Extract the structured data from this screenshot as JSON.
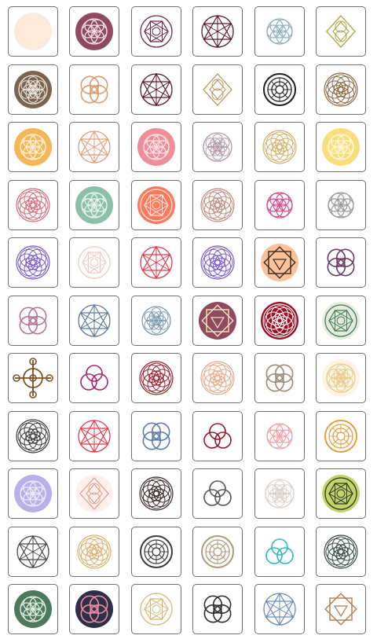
{
  "gallery": {
    "icons": [
      {
        "name": "rose-mandala-icon",
        "bg": "#fdeadb",
        "stroke": "#a8324a",
        "motif": "rose"
      },
      {
        "name": "seed-of-life-icon",
        "bg": "#8e4a60",
        "stroke": "#f6e6ea",
        "motif": "seed"
      },
      {
        "name": "hexagon-mandala-icon",
        "bg": "",
        "stroke": "#6b2a4a",
        "motif": "hexring"
      },
      {
        "name": "star-flower-icon",
        "bg": "",
        "stroke": "#5a1a2e",
        "motif": "star"
      },
      {
        "name": "interlaced-circles-icon",
        "bg": "",
        "stroke": "#8fb2ba",
        "motif": "seed"
      },
      {
        "name": "vesica-diamond-icon",
        "bg": "",
        "stroke": "#a8a23a",
        "motif": "diamond"
      },
      {
        "name": "flower-of-life-icon",
        "bg": "#7a6450",
        "stroke": "#f3ece3",
        "motif": "flower"
      },
      {
        "name": "knot-rings-icon",
        "bg": "",
        "stroke": "#d89a6f",
        "motif": "knot"
      },
      {
        "name": "star-flower-icon",
        "bg": "",
        "stroke": "#5a1a2e",
        "motif": "star"
      },
      {
        "name": "diamond-arrow-icon",
        "bg": "",
        "stroke": "#b8975a",
        "motif": "diamond"
      },
      {
        "name": "concentric-circles-icon",
        "bg": "",
        "stroke": "#1f1f1f",
        "motif": "rings"
      },
      {
        "name": "rosette-ring-icon",
        "bg": "",
        "stroke": "#8a6a44",
        "motif": "rosette"
      },
      {
        "name": "seed-of-life-icon",
        "bg": "#f3b758",
        "stroke": "#fdf2dc",
        "motif": "seed"
      },
      {
        "name": "star-flower-icon",
        "bg": "",
        "stroke": "#dba07e",
        "motif": "star"
      },
      {
        "name": "seed-of-life-icon",
        "bg": "#ec8f98",
        "stroke": "#fbe3e6",
        "motif": "seed"
      },
      {
        "name": "flower-of-life-icon",
        "bg": "",
        "stroke": "#b197a5",
        "motif": "flower"
      },
      {
        "name": "rosette-ring-icon",
        "bg": "",
        "stroke": "#d1b06a",
        "motif": "rosette"
      },
      {
        "name": "seed-of-life-icon",
        "bg": "#f7df7e",
        "stroke": "#fff7d8",
        "motif": "seed"
      },
      {
        "name": "rosette-ring-icon",
        "bg": "",
        "stroke": "#d66a7a",
        "motif": "rosette"
      },
      {
        "name": "seed-of-life-icon",
        "bg": "#8cc0aa",
        "stroke": "#eaf6ef",
        "motif": "seed"
      },
      {
        "name": "hexagon-mandala-icon",
        "bg": "#fa7a5e",
        "stroke": "#ffe5dc",
        "motif": "hexring"
      },
      {
        "name": "spiral-rosette-icon",
        "bg": "",
        "stroke": "#c08a80",
        "motif": "rosette"
      },
      {
        "name": "multicolor-circles-icon",
        "bg": "",
        "stroke": "#d14d8f",
        "motif": "seed"
      },
      {
        "name": "seed-of-life-icon",
        "bg": "",
        "stroke": "#9a9a9a",
        "motif": "seed"
      },
      {
        "name": "rosette-ring-icon",
        "bg": "",
        "stroke": "#7a5ac8",
        "motif": "rosette"
      },
      {
        "name": "merkaba-icon",
        "bg": "",
        "stroke": "#f0c8c8",
        "motif": "hexring"
      },
      {
        "name": "star-flower-icon",
        "bg": "",
        "stroke": "#e03a4e",
        "motif": "star"
      },
      {
        "name": "rosette-ring-icon",
        "bg": "",
        "stroke": "#7a5ac8",
        "motif": "rosette"
      },
      {
        "name": "square-triangle-icon",
        "bg": "#f9c29b",
        "stroke": "#3d2a20",
        "motif": "squares"
      },
      {
        "name": "knot-rings-icon",
        "bg": "",
        "stroke": "#6a3a5e",
        "motif": "knot"
      },
      {
        "name": "pentagon-knot-icon",
        "bg": "",
        "stroke": "#b07898",
        "motif": "knot"
      },
      {
        "name": "star-flower-icon",
        "bg": "",
        "stroke": "#5e7c94",
        "motif": "star"
      },
      {
        "name": "flower-of-life-icon",
        "bg": "",
        "stroke": "#7a9ab0",
        "motif": "flower"
      },
      {
        "name": "square-triangle-icon",
        "bg": "#8e4a60",
        "stroke": "#f6e0c0",
        "motif": "squares"
      },
      {
        "name": "rosette-ring-icon",
        "bg": "#9e0f24",
        "stroke": "#ffffff",
        "motif": "rosette"
      },
      {
        "name": "hexagon-mandala-icon",
        "bg": "#e6ecd8",
        "stroke": "#3f7a6a",
        "motif": "hexring"
      },
      {
        "name": "circle-cross-icon",
        "bg": "",
        "stroke": "#7a5224",
        "motif": "cross"
      },
      {
        "name": "triple-rings-icon",
        "bg": "",
        "stroke": "#a8246a",
        "motif": "triple"
      },
      {
        "name": "rosette-ring-icon",
        "bg": "",
        "stroke": "#9e1f2e",
        "motif": "rosette"
      },
      {
        "name": "sun-mandala-icon",
        "bg": "",
        "stroke": "#e8a88a",
        "motif": "rosette"
      },
      {
        "name": "interlaced-knot-icon",
        "bg": "",
        "stroke": "#9a8a7a",
        "motif": "knot"
      },
      {
        "name": "flower-of-life-icon",
        "bg": "#fdf4e2",
        "stroke": "#e6c98c",
        "motif": "flower"
      },
      {
        "name": "rosette-ring-icon",
        "bg": "",
        "stroke": "#3a3a3a",
        "motif": "rosette"
      },
      {
        "name": "star-flower-icon",
        "bg": "",
        "stroke": "#e03a4e",
        "motif": "star"
      },
      {
        "name": "interlaced-knot-icon",
        "bg": "",
        "stroke": "#5a7ab0",
        "motif": "knot"
      },
      {
        "name": "triquetra-icon",
        "bg": "",
        "stroke": "#9e1230",
        "motif": "triple"
      },
      {
        "name": "seed-of-life-icon",
        "bg": "",
        "stroke": "#f0a0a8",
        "motif": "seed"
      },
      {
        "name": "aperture-icon",
        "bg": "",
        "stroke": "#e0a040",
        "motif": "rings"
      },
      {
        "name": "seed-of-life-icon",
        "bg": "#b8b0e6",
        "stroke": "#efeafc",
        "motif": "seed"
      },
      {
        "name": "diamond-arrow-icon",
        "bg": "#fdf0ec",
        "stroke": "#e0a090",
        "motif": "diamond"
      },
      {
        "name": "rosette-ring-icon",
        "bg": "",
        "stroke": "#3a2a2a",
        "motif": "rosette"
      },
      {
        "name": "triquetra-icon",
        "bg": "",
        "stroke": "#555555",
        "motif": "triple"
      },
      {
        "name": "flower-of-life-icon",
        "bg": "",
        "stroke": "#d8d0c8",
        "motif": "flower"
      },
      {
        "name": "star-of-david-icon",
        "bg": "#c4d46c",
        "stroke": "#2e3a18",
        "motif": "hexring"
      },
      {
        "name": "metatron-cube-icon",
        "bg": "",
        "stroke": "#4a4a4a",
        "motif": "star"
      },
      {
        "name": "rosette-ring-icon",
        "bg": "",
        "stroke": "#d8b070",
        "motif": "rosette"
      },
      {
        "name": "concentric-circles-icon",
        "bg": "",
        "stroke": "#3a3a3a",
        "motif": "rings"
      },
      {
        "name": "sun-mandala-icon",
        "bg": "",
        "stroke": "#b09a7a",
        "motif": "rings"
      },
      {
        "name": "triple-rings-icon",
        "bg": "",
        "stroke": "#30b8c0",
        "motif": "triple"
      },
      {
        "name": "rosette-ring-icon",
        "bg": "",
        "stroke": "#3a4a48",
        "motif": "rosette"
      },
      {
        "name": "seed-of-life-icon",
        "bg": "#4e7a5c",
        "stroke": "#e4f0e6",
        "motif": "seed"
      },
      {
        "name": "knot-rings-icon",
        "bg": "#2c3048",
        "stroke": "#f08aa0",
        "motif": "knot"
      },
      {
        "name": "merkaba-icon",
        "bg": "",
        "stroke": "#d4b87a",
        "motif": "hexring"
      },
      {
        "name": "interlaced-circles-icon",
        "bg": "",
        "stroke": "#2e2e2e",
        "motif": "knot"
      },
      {
        "name": "star-flower-icon",
        "bg": "",
        "stroke": "#6a8ab0",
        "motif": "star"
      },
      {
        "name": "square-triangle-icon",
        "bg": "",
        "stroke": "#b07a50",
        "motif": "squares"
      }
    ]
  }
}
